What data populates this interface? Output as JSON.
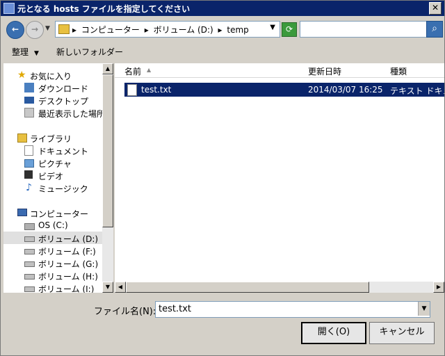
{
  "window": {
    "title": "元となる hosts ファイルを指定してください",
    "close_glyph": "✕"
  },
  "address": {
    "crumbs": [
      "▸",
      "コンピューター",
      "▸",
      "ボリューム (D:)",
      "▸",
      "temp"
    ],
    "search_placeholder": ""
  },
  "toolbar": {
    "organize": "整理",
    "new_folder": "新しいフォルダー"
  },
  "nav": {
    "favorites": "お気に入り",
    "downloads": "ダウンロード",
    "desktop": "デスクトップ",
    "recent": "最近表示した場所",
    "libraries": "ライブラリ",
    "documents": "ドキュメント",
    "pictures": "ピクチャ",
    "videos": "ビデオ",
    "music": "ミュージック",
    "computer": "コンピューター",
    "c_drive": "OS (C:)",
    "d_drive": "ボリューム (D:)",
    "f_drive": "ボリューム (F:)",
    "g_drive": "ボリューム (G:)",
    "h_drive": "ボリューム (H:)",
    "i_drive": "ボリューム (I:)"
  },
  "columns": {
    "name": "名前",
    "modified": "更新日時",
    "type": "種類"
  },
  "files": [
    {
      "name": "test.txt",
      "modified": "2014/03/07 16:25",
      "type": "テキスト ドキュメント"
    }
  ],
  "footer": {
    "filename_label": "ファイル名(N):",
    "filename_value": "test.txt",
    "open": "開く(O)",
    "cancel": "キャンセル"
  },
  "colors": {
    "selection": "#0a246a",
    "titlebar": "#0a246a",
    "face": "#d4d0c8"
  }
}
